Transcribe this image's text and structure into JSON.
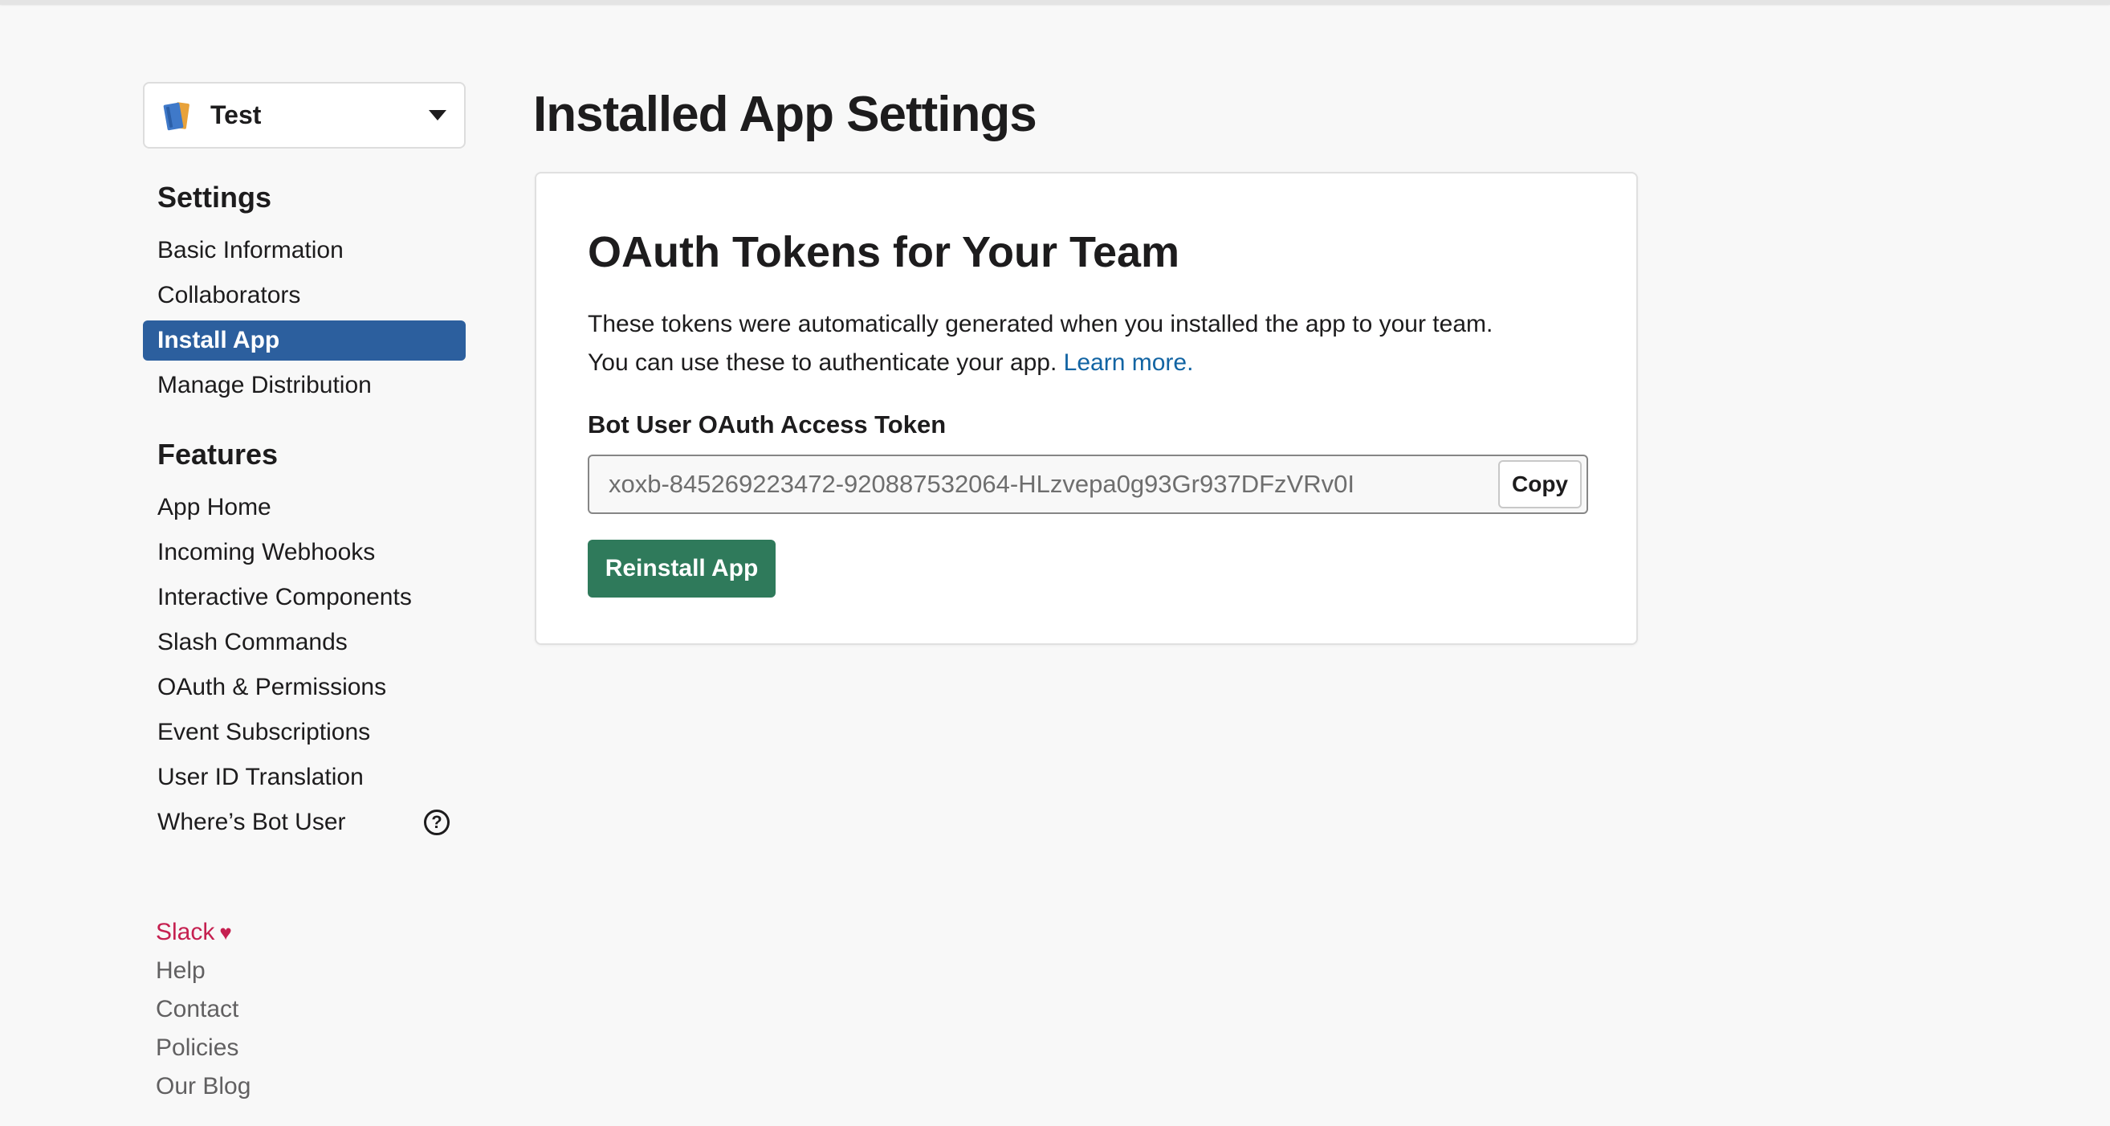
{
  "colors": {
    "page_background": "#f8f8f8",
    "active_nav": "#2c5f9e",
    "primary_button": "#2f7a5b",
    "link": "#1264a3",
    "brand_pink": "#c52050"
  },
  "sidebar": {
    "app_switcher": {
      "icon": "app-book-icon",
      "name": "Test",
      "dropdown_icon": "caret-down-icon"
    },
    "settings_title": "Settings",
    "settings_items": [
      {
        "label": "Basic Information",
        "active": false
      },
      {
        "label": "Collaborators",
        "active": false
      },
      {
        "label": "Install App",
        "active": true
      },
      {
        "label": "Manage Distribution",
        "active": false
      }
    ],
    "features_title": "Features",
    "features_items": [
      {
        "label": "App Home"
      },
      {
        "label": "Incoming Webhooks"
      },
      {
        "label": "Interactive Components"
      },
      {
        "label": "Slash Commands"
      },
      {
        "label": "OAuth & Permissions"
      },
      {
        "label": "Event Subscriptions"
      },
      {
        "label": "User ID Translation"
      },
      {
        "label": "Where’s Bot User",
        "icon": "help-circle-icon",
        "icon_glyph": "?"
      }
    ],
    "footer": {
      "brand": "Slack",
      "brand_icon": "heart-icon",
      "links": [
        "Help",
        "Contact",
        "Policies",
        "Our Blog"
      ]
    }
  },
  "main": {
    "page_title": "Installed App Settings",
    "card": {
      "title": "OAuth Tokens for Your Team",
      "description_line1": "These tokens were automatically generated when you installed the app to your team.",
      "description_line2": "You can use these to authenticate your app.",
      "learn_more": "Learn more.",
      "token_label": "Bot User OAuth Access Token",
      "token_value": "xoxb-845269223472-920887532064-HLzvepa0g93Gr937DFzVRv0I",
      "copy_button": "Copy",
      "reinstall_button": "Reinstall App"
    }
  }
}
